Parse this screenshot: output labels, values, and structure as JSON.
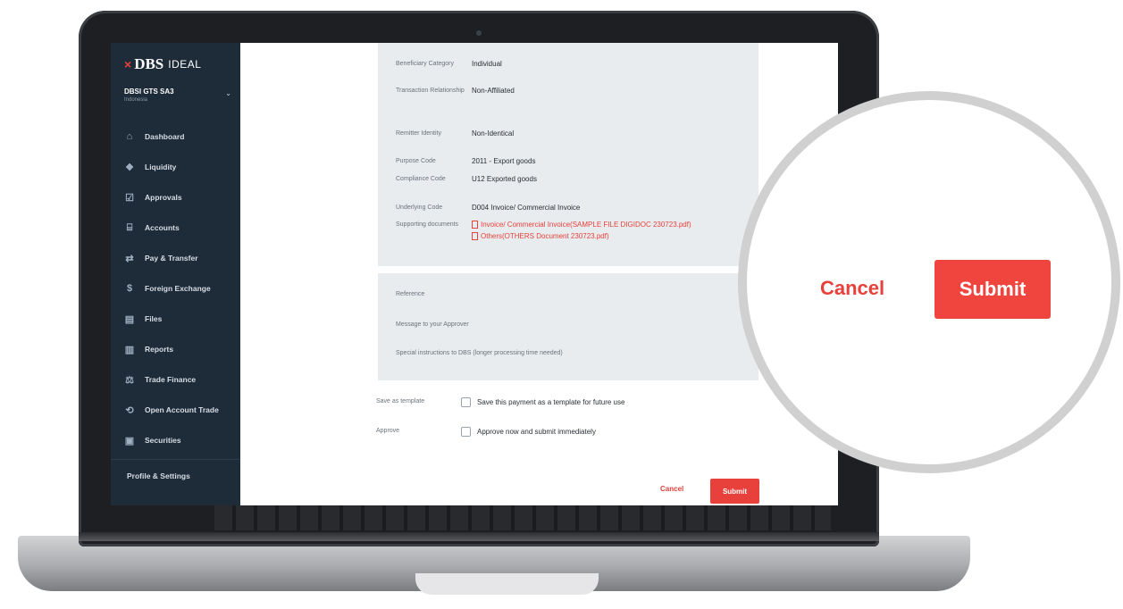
{
  "brand": {
    "logo_mark": "×",
    "logo": "DBS",
    "product": "IDEAL"
  },
  "account": {
    "name": "DBSI GTS SA3",
    "country": "Indonesia"
  },
  "nav": [
    {
      "label": "Dashboard",
      "icon": "home-icon"
    },
    {
      "label": "Liquidity",
      "icon": "liquidity-icon"
    },
    {
      "label": "Approvals",
      "icon": "approvals-icon"
    },
    {
      "label": "Accounts",
      "icon": "bank-icon"
    },
    {
      "label": "Pay & Transfer",
      "icon": "transfer-icon"
    },
    {
      "label": "Foreign Exchange",
      "icon": "fx-icon"
    },
    {
      "label": "Files",
      "icon": "file-icon"
    },
    {
      "label": "Reports",
      "icon": "reports-icon"
    },
    {
      "label": "Trade Finance",
      "icon": "trade-icon"
    },
    {
      "label": "Open Account Trade",
      "icon": "open-account-icon"
    },
    {
      "label": "Securities",
      "icon": "securities-icon"
    }
  ],
  "profile_label": "Profile & Settings",
  "details": {
    "beneficiary_category": {
      "label": "Beneficiary Category",
      "value": "Individual"
    },
    "transaction_relationship": {
      "label": "Transaction Relationship",
      "value": "Non-Affiliated"
    },
    "remitter_identity": {
      "label": "Remitter Identity",
      "value": "Non-Identical"
    },
    "purpose_code": {
      "label": "Purpose Code",
      "value": "2011 - Export goods"
    },
    "compliance_code": {
      "label": "Compliance Code",
      "value": "U12 Exported goods"
    },
    "underlying_code": {
      "label": "Underlying Code",
      "value": "D004 Invoice/ Commercial Invoice"
    },
    "supporting_documents": {
      "label": "Supporting documents",
      "files": [
        "Invoice/ Commercial Invoice(SAMPLE FILE DIGIDOC 230723.pdf)",
        "Others(OTHERS Document 230723.pdf)"
      ]
    }
  },
  "extra": {
    "reference": "Reference",
    "message": "Message to your Approver",
    "special": "Special instructions to DBS (longer processing time needed)"
  },
  "options": {
    "template_label": "Save as template",
    "template_text": "Save this payment as a template for future use",
    "approve_label": "Approve",
    "approve_text": "Approve now and submit immediately"
  },
  "actions": {
    "cancel": "Cancel",
    "submit": "Submit"
  },
  "colors": {
    "accent": "#e8403a",
    "sidebar": "#1e2b38",
    "panel": "#e8ecef"
  }
}
